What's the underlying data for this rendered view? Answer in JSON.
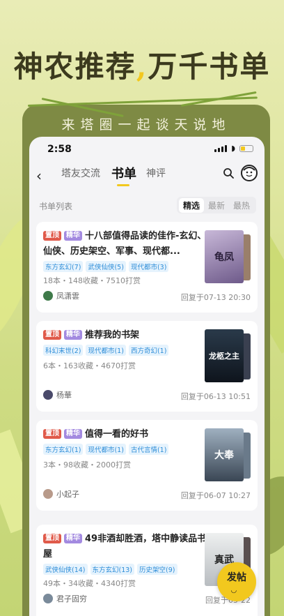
{
  "promo": {
    "headline_part1": "神农推荐",
    "headline_comma": ",",
    "headline_part2": "万千书单",
    "slogan": "来塔圈一起谈天说地"
  },
  "status_bar": {
    "time": "2:58"
  },
  "nav": {
    "tabs": [
      {
        "label": "塔友交流",
        "active": false
      },
      {
        "label": "书单",
        "active": true
      },
      {
        "label": "神评",
        "active": false
      }
    ]
  },
  "section": {
    "title": "书单列表",
    "filters": [
      {
        "label": "精选",
        "active": true
      },
      {
        "label": "最新",
        "active": false
      },
      {
        "label": "最热",
        "active": false
      }
    ]
  },
  "badges": {
    "top": "置顶",
    "fine": "精华"
  },
  "cards": [
    {
      "title": "十八部值得品读的佳作-玄幻、仙侠、历史架空、军事、现代都...",
      "tags": [
        "东方玄幻(7)",
        "武侠仙侠(5)",
        "现代都市(3)"
      ],
      "stats": "18本・148收藏・7510打赏",
      "author": "凤潇雲",
      "reply": "回复于07-13 20:30",
      "cover_text": "龟凤"
    },
    {
      "title": "推荐我的书架",
      "tags": [
        "科幻末世(2)",
        "现代都市(1)",
        "西方奇幻(1)"
      ],
      "stats": "6本・163收藏・4670打赏",
      "author": "杨華",
      "reply": "回复于06-13 10:51",
      "cover_text": "龙柩之主"
    },
    {
      "title": "值得一看的好书",
      "tags": [
        "东方玄幻(1)",
        "现代都市(1)",
        "古代言情(1)"
      ],
      "stats": "3本・98收藏・2000打赏",
      "author": "小起子",
      "reply": "回复于06-07 10:27",
      "cover_text": "大奉"
    },
    {
      "title": "49非酒却胜酒，塔中静读品书屋",
      "tags": [
        "武侠仙侠(14)",
        "东方玄幻(13)",
        "历史架空(9)"
      ],
      "stats": "49本・34收藏・4340打赏",
      "author": "君子固穷",
      "reply": "回复于05-22",
      "cover_text": "真武"
    }
  ],
  "fab": {
    "label": "发帖"
  },
  "colors": {
    "accent": "#f2c81e",
    "frame": "#7e8a44",
    "tag_text": "#2d8dd8",
    "badge_top": "#e05a4a",
    "badge_fine": "#a38ae0"
  }
}
